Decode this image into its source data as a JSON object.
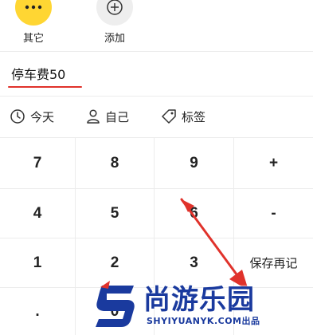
{
  "categories": [
    {
      "label": "其它",
      "icon": "more-dots-icon",
      "color": "#ffd633"
    },
    {
      "label": "添加",
      "icon": "add-icon",
      "color": "#eeeeee"
    }
  ],
  "note": {
    "value": "停车费50"
  },
  "options": {
    "date_label": "今天",
    "member_label": "自己",
    "tag_label": "标签"
  },
  "keypad": {
    "rows": [
      [
        "7",
        "8",
        "9",
        "+"
      ],
      [
        "4",
        "5",
        "6",
        "-"
      ],
      [
        "1",
        "2",
        "3",
        "保存再记"
      ],
      [
        ".",
        "0",
        "",
        ""
      ]
    ]
  },
  "watermark": {
    "text": "尚游乐园",
    "domain": "SHYIYUANYK.COM",
    "suffix": "出品",
    "accent_color": "#1a3a9e"
  },
  "colors": {
    "accent_red": "#e0322b",
    "brand_yellow": "#ffd633"
  }
}
